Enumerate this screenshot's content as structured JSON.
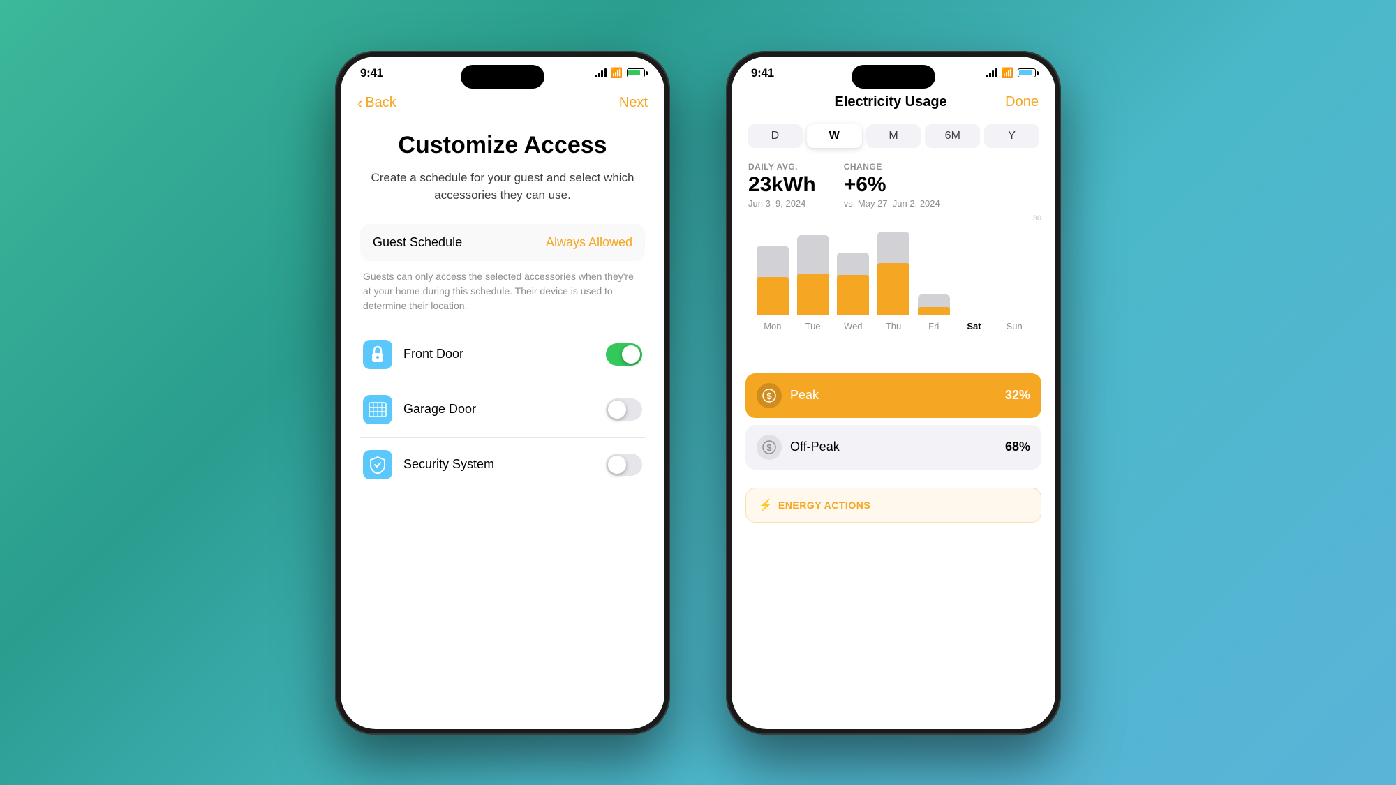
{
  "phone1": {
    "statusBar": {
      "time": "9:41",
      "theme": "light"
    },
    "nav": {
      "back": "Back",
      "next": "Next"
    },
    "title": "Customize Access",
    "subtitle": "Create a schedule for your guest and select which accessories they can use.",
    "guestSchedule": {
      "label": "Guest Schedule",
      "value": "Always Allowed",
      "description": "Guests can only access the selected accessories when they're at your home during this schedule. Their device is used to determine their location."
    },
    "accessories": [
      {
        "name": "Front Door",
        "type": "lock",
        "enabled": true
      },
      {
        "name": "Garage Door",
        "type": "garage",
        "enabled": false
      },
      {
        "name": "Security System",
        "type": "security",
        "enabled": false
      }
    ]
  },
  "phone2": {
    "statusBar": {
      "time": "9:41",
      "theme": "light"
    },
    "header": {
      "title": "Electricity Usage",
      "done": "Done"
    },
    "tabs": [
      "D",
      "W",
      "M",
      "6M",
      "Y"
    ],
    "activeTab": "W",
    "stats": {
      "dailyAvgLabel": "DAILY AVG.",
      "dailyAvgValue": "23kWh",
      "dailyAvgDate": "Jun 3–9, 2024",
      "changeLabel": "CHANGE",
      "changeValue": "+6%",
      "changeDate": "vs. May 27–Jun 2, 2024"
    },
    "chart": {
      "gridLabel": "30",
      "bars": [
        {
          "day": "Mon",
          "grayHeight": 100,
          "orangeHeight": 55,
          "active": false
        },
        {
          "day": "Tue",
          "grayHeight": 115,
          "orangeHeight": 60,
          "active": false
        },
        {
          "day": "Wed",
          "grayHeight": 90,
          "orangeHeight": 58,
          "active": false
        },
        {
          "day": "Thu",
          "grayHeight": 120,
          "orangeHeight": 75,
          "active": false
        },
        {
          "day": "Fri",
          "grayHeight": 30,
          "orangeHeight": 12,
          "active": false
        },
        {
          "day": "Sat",
          "grayHeight": 0,
          "orangeHeight": 0,
          "active": true
        },
        {
          "day": "Sun",
          "grayHeight": 0,
          "orangeHeight": 0,
          "active": false
        }
      ]
    },
    "legend": [
      {
        "name": "Peak",
        "percentage": "32%",
        "type": "peak"
      },
      {
        "name": "Off-Peak",
        "percentage": "68%",
        "type": "offpeak"
      }
    ],
    "energyActions": {
      "label": "ENERGY ACTIONS"
    }
  }
}
